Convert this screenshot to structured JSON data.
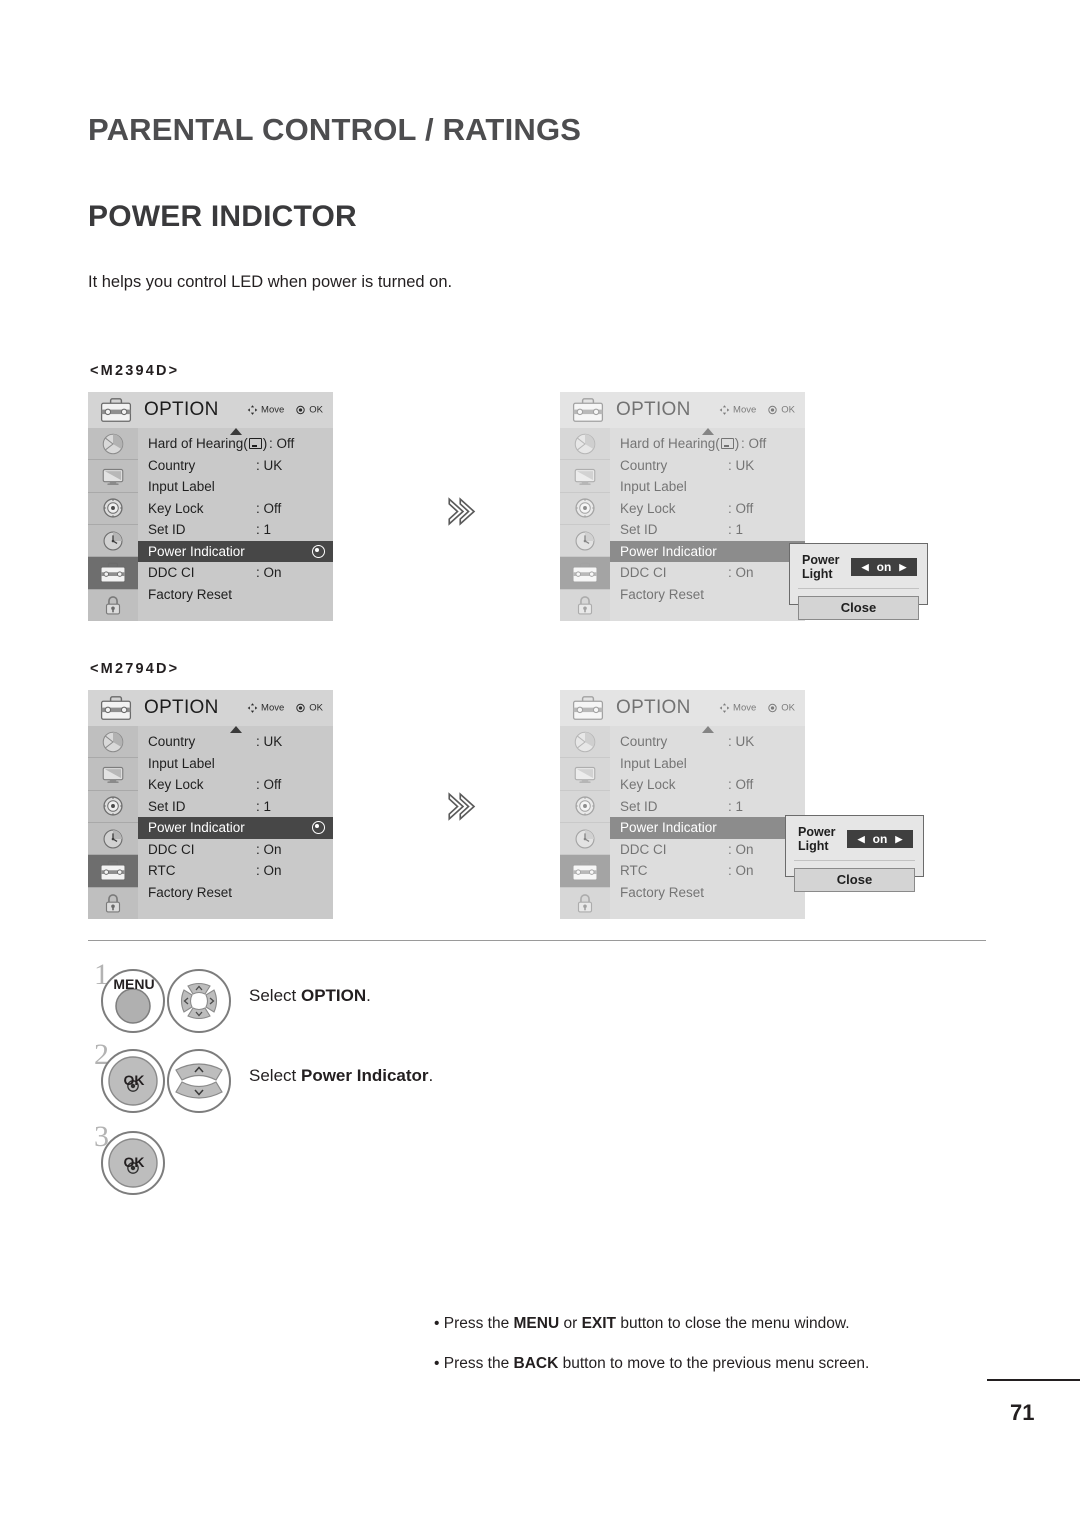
{
  "page": {
    "title": "PARENTAL CONTROL / RATINGS",
    "section": "POWER INDICTOR",
    "intro": "It helps you control LED when power is turned on.",
    "number": "71"
  },
  "models": [
    {
      "label": "<M2394D>"
    },
    {
      "label": "<M2794D>"
    }
  ],
  "osd": {
    "title": "OPTION",
    "hint_move": "Move",
    "hint_ok": "OK",
    "rail_icons": [
      "picture-icon",
      "screen-icon",
      "audio-icon",
      "time-icon",
      "option-icon",
      "lock-icon"
    ],
    "m2394d": {
      "rows": [
        {
          "label": "Hard of Hearing(",
          "suffix": ")",
          "has_box": true,
          "value": ": Off",
          "selected": false
        },
        {
          "label": "Country",
          "value": ": UK",
          "selected": false
        },
        {
          "label": "Input Label",
          "value": "",
          "selected": false
        },
        {
          "label": "Key Lock",
          "value": ": Off",
          "selected": false
        },
        {
          "label": "Set ID",
          "value": ": 1",
          "selected": false
        },
        {
          "label": "Power Indicatior",
          "value": "",
          "selected": true
        },
        {
          "label": "DDC CI",
          "value": ": On",
          "selected": false
        },
        {
          "label": "Factory Reset",
          "value": "",
          "selected": false
        }
      ]
    },
    "m2794d": {
      "rows": [
        {
          "label": "Country",
          "value": ": UK",
          "selected": false
        },
        {
          "label": "Input Label",
          "value": "",
          "selected": false
        },
        {
          "label": "Key Lock",
          "value": ": Off",
          "selected": false
        },
        {
          "label": "Set ID",
          "value": ": 1",
          "selected": false
        },
        {
          "label": "Power Indicatior",
          "value": "",
          "selected": true
        },
        {
          "label": "DDC CI",
          "value": ": On",
          "selected": false
        },
        {
          "label": "RTC",
          "value": ": On",
          "selected": false
        },
        {
          "label": "Factory Reset",
          "value": "",
          "selected": false
        }
      ]
    }
  },
  "popup": {
    "label": "Power Light",
    "value": "on",
    "left_arrow": "◀",
    "right_arrow": "▶",
    "close_label": "Close"
  },
  "steps": [
    {
      "num": "1",
      "key_label": "MENU",
      "text_plain": "Select ",
      "text_bold": "OPTION",
      "text_tail": "."
    },
    {
      "num": "2",
      "key_label": "OK",
      "text_plain": "Select ",
      "text_bold": "Power Indicator",
      "text_tail": "."
    },
    {
      "num": "3",
      "key_label": "OK",
      "text_plain": "",
      "text_bold": "",
      "text_tail": ""
    }
  ],
  "notes": {
    "note1_a": "• Press the ",
    "note1_b": "MENU",
    "note1_c": " or ",
    "note1_d": "EXIT",
    "note1_e": " button to close the menu window.",
    "note2_a": "• Press the ",
    "note2_b": "BACK",
    "note2_c": " button to move to the previous menu screen."
  },
  "colors": {
    "heading": "#4d4d4f",
    "osd_bg": "#c9c9c9",
    "osd_header": "#d4d4d4",
    "osd_rail": "#bfbfbf",
    "osd_selected": "#474747",
    "popup_bg": "#e6e6e6"
  }
}
